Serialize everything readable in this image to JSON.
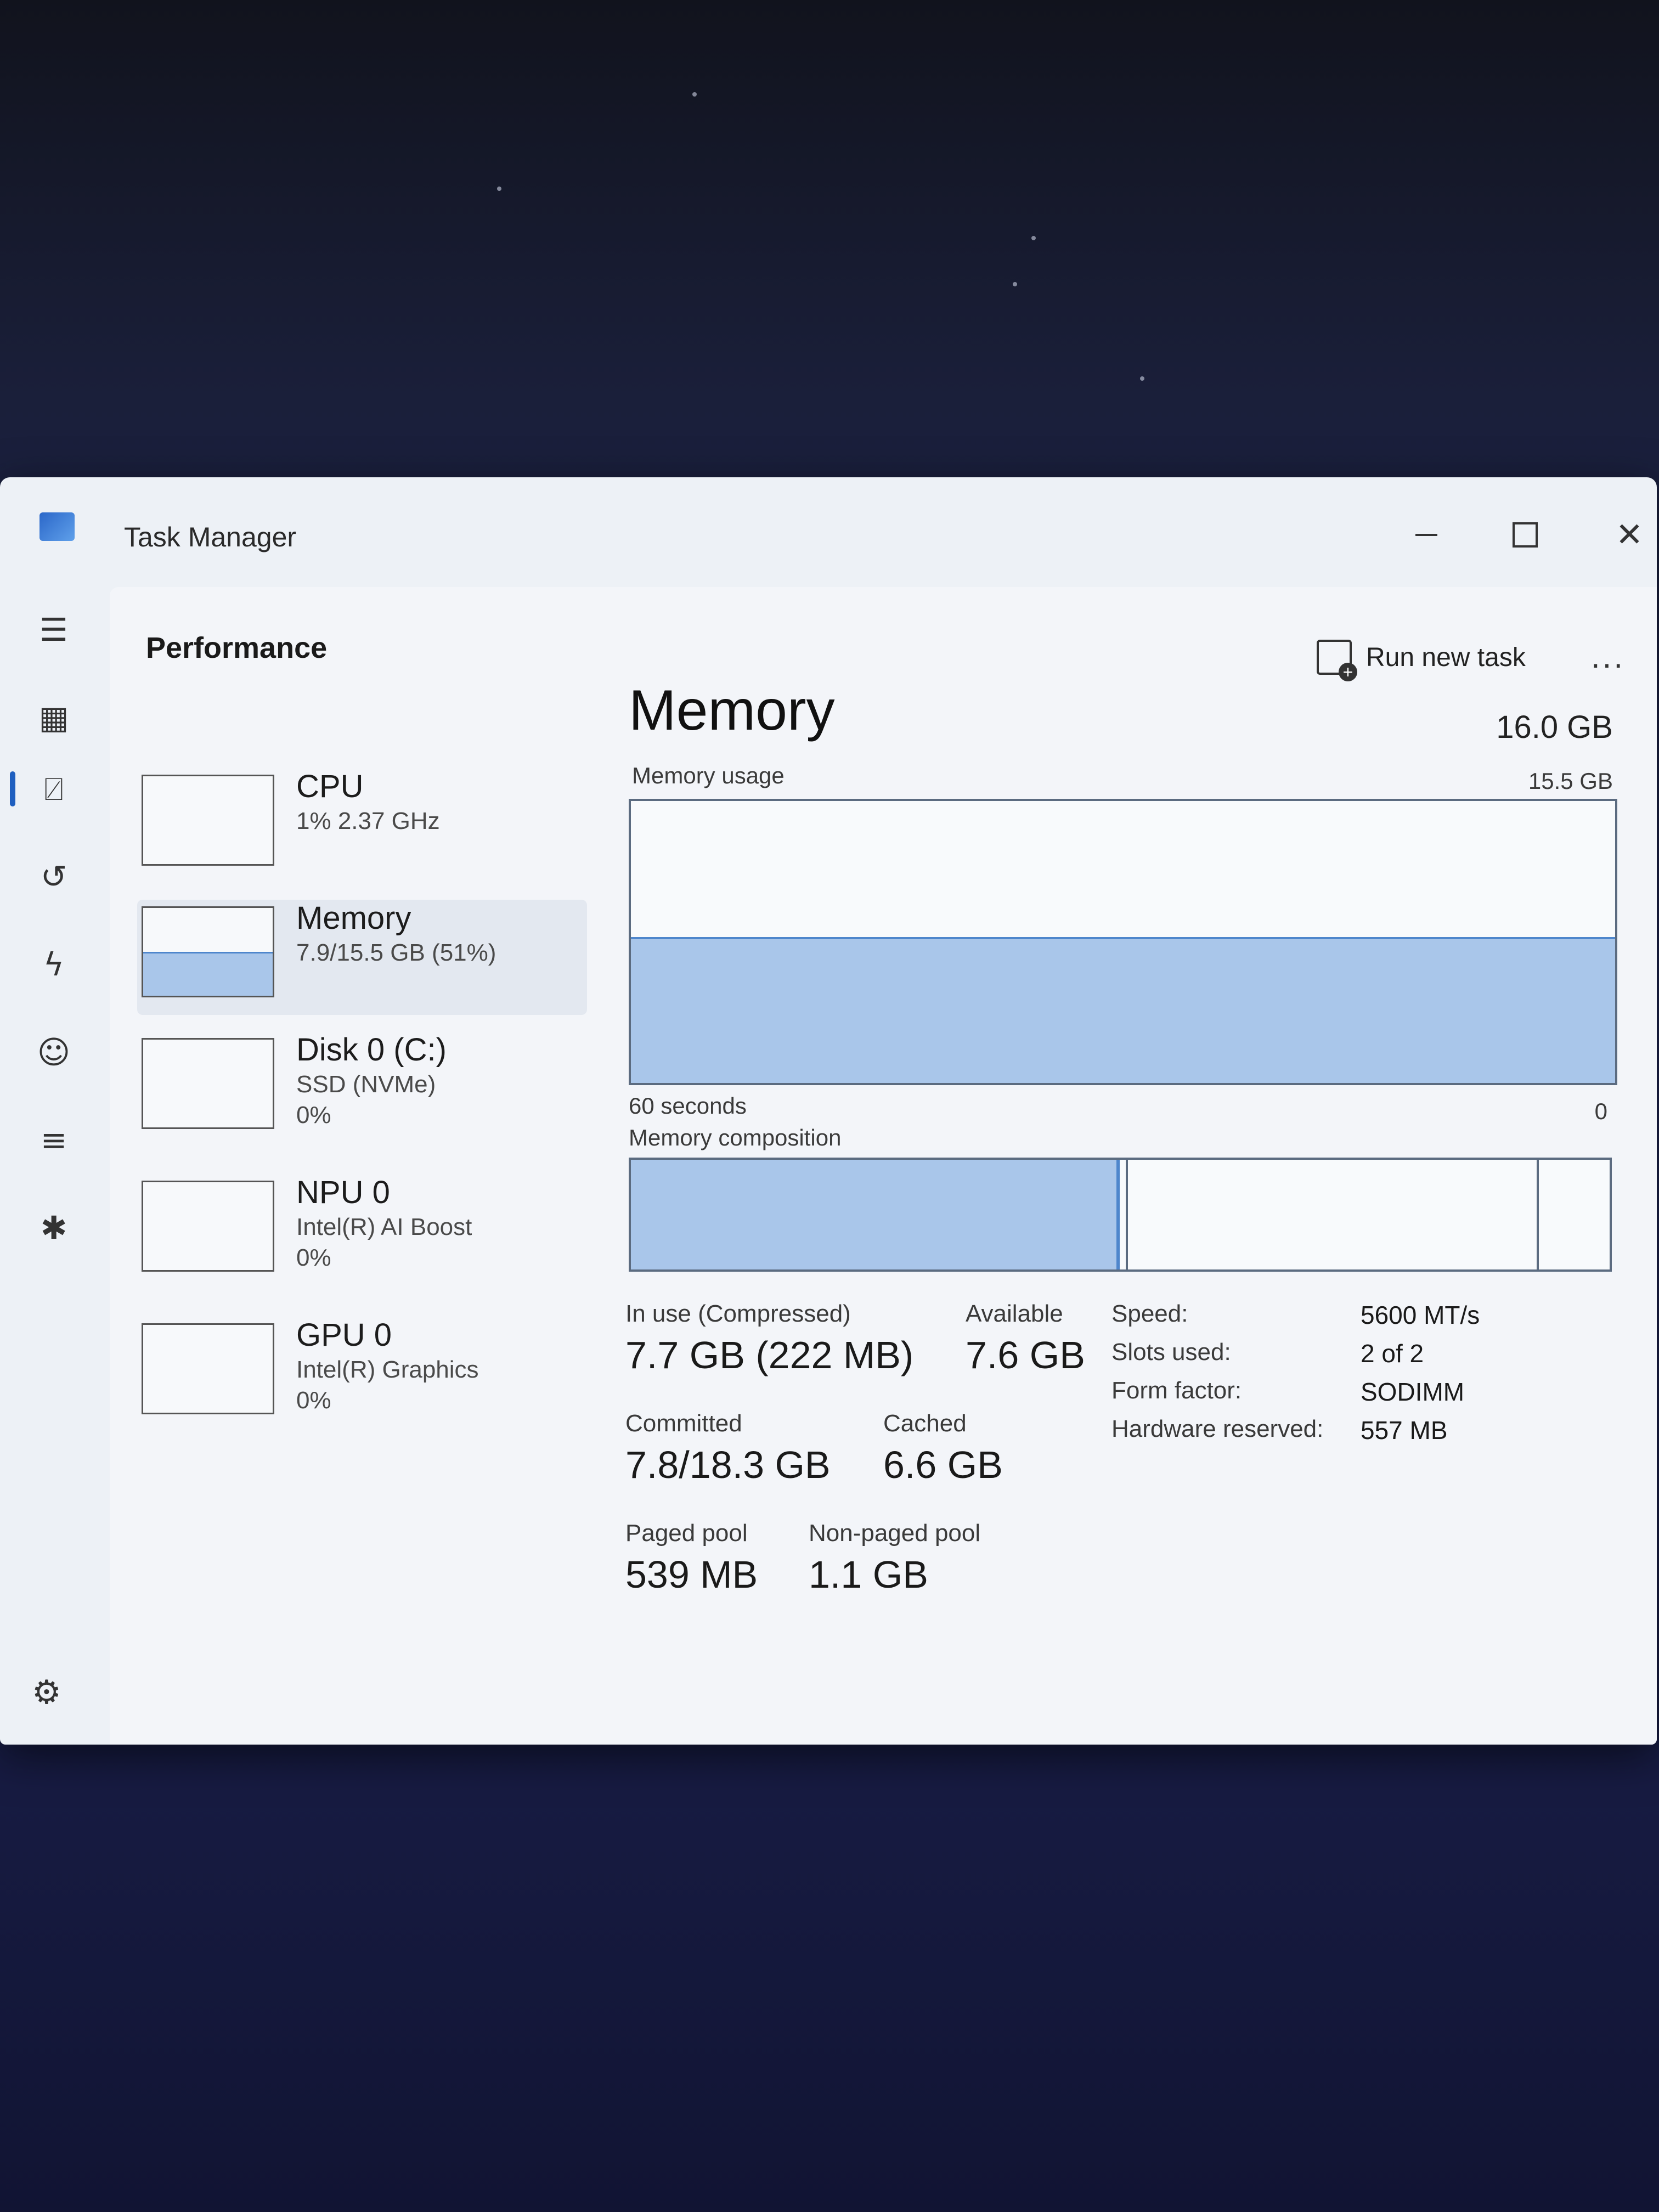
{
  "window": {
    "title": "Task Manager"
  },
  "header": {
    "page_title": "Performance",
    "run_new_task_label": "Run new task",
    "more_label": "..."
  },
  "nav": {
    "icons": [
      "hamburger-icon",
      "processes-icon",
      "performance-icon",
      "app-history-icon",
      "startup-apps-icon",
      "users-icon",
      "details-icon",
      "services-icon",
      "settings-icon"
    ],
    "active": "performance-icon"
  },
  "resources": [
    {
      "name": "CPU",
      "sub1": "1% 2.37 GHz",
      "sub2": ""
    },
    {
      "name": "Memory",
      "sub1": "7.9/15.5 GB (51%)",
      "sub2": ""
    },
    {
      "name": "Disk 0 (C:)",
      "sub1": "SSD (NVMe)",
      "sub2": "0%"
    },
    {
      "name": "NPU 0",
      "sub1": "Intel(R) AI Boost",
      "sub2": "0%"
    },
    {
      "name": "GPU 0",
      "sub1": "Intel(R) Graphics",
      "sub2": "0%"
    }
  ],
  "detail": {
    "title": "Memory",
    "total": "16.0 GB",
    "usage_label": "Memory usage",
    "usage_max": "15.5 GB",
    "usage_fraction": 0.51,
    "graph_time_label": "60 seconds",
    "graph_zero_label": "0",
    "composition_label": "Memory composition",
    "stats": {
      "in_use_label": "In use (Compressed)",
      "in_use_value": "7.7 GB (222 MB)",
      "available_label": "Available",
      "available_value": "7.6 GB",
      "committed_label": "Committed",
      "committed_value": "7.8/18.3 GB",
      "cached_label": "Cached",
      "cached_value": "6.6 GB",
      "paged_pool_label": "Paged pool",
      "paged_pool_value": "539 MB",
      "non_paged_pool_label": "Non-paged pool",
      "non_paged_pool_value": "1.1 GB"
    },
    "specs": {
      "speed_label": "Speed:",
      "speed_value": "5600 MT/s",
      "slots_label": "Slots used:",
      "slots_value": "2 of 2",
      "form_label": "Form factor:",
      "form_value": "SODIMM",
      "hw_reserved_label": "Hardware reserved:",
      "hw_reserved_value": "557 MB"
    }
  },
  "colors": {
    "accent": "#1f5fbf",
    "memory_fill": "#a9c6ea",
    "memory_line": "#4e86cc",
    "window_bg": "#edf1f6"
  }
}
